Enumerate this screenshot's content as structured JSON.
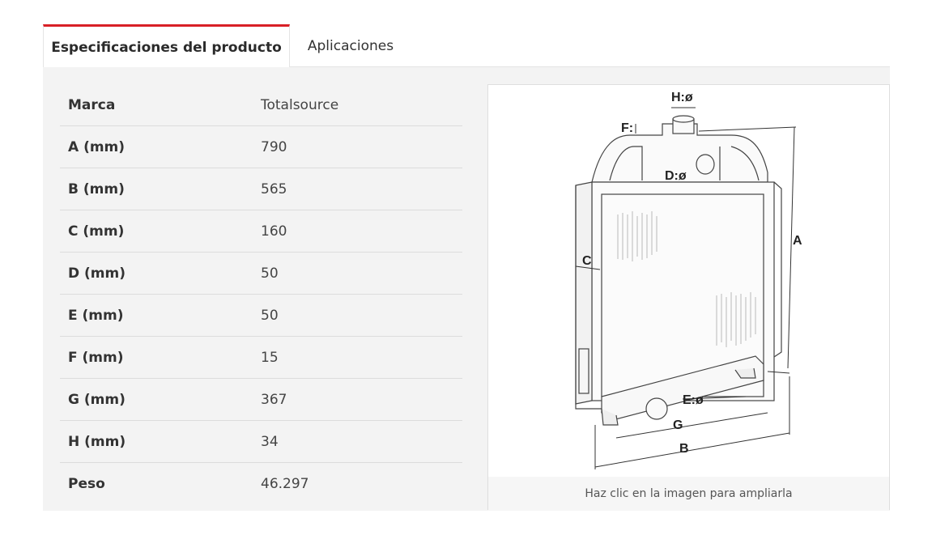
{
  "tabs": [
    {
      "label": "Especificaciones del producto",
      "active": true
    },
    {
      "label": "Aplicaciones",
      "active": false
    }
  ],
  "specs": [
    {
      "label": "Marca",
      "value": "Totalsource"
    },
    {
      "label": "A (mm)",
      "value": "790"
    },
    {
      "label": "B (mm)",
      "value": "565"
    },
    {
      "label": "C (mm)",
      "value": "160"
    },
    {
      "label": "D (mm)",
      "value": "50"
    },
    {
      "label": "E (mm)",
      "value": "50"
    },
    {
      "label": "F (mm)",
      "value": "15"
    },
    {
      "label": "G (mm)",
      "value": "367"
    },
    {
      "label": "H (mm)",
      "value": "34"
    },
    {
      "label": "Peso",
      "value": "46.297"
    }
  ],
  "diagram": {
    "labels": {
      "h": "H:ø",
      "f": "F:",
      "d": "D:ø",
      "a": "A",
      "c": "C",
      "e": "E:ø",
      "g": "G",
      "b": "B"
    }
  },
  "image_caption": "Haz clic en la imagen para ampliarla",
  "colors": {
    "accent": "#d81f26",
    "panel_bg": "#f3f3f3"
  }
}
